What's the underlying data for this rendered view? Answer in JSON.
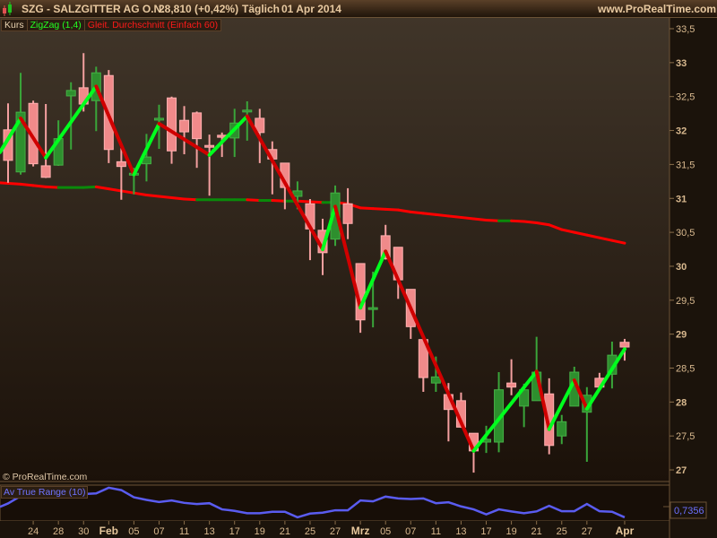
{
  "header": {
    "symbol_title": "SZG - SALZGITTER AG O.N.",
    "price_change": "28,810 (+0,42%)",
    "period": "Täglich",
    "date": "01 Apr 2014",
    "website": "www.ProRealTime.com",
    "icon": "candlestick-icon"
  },
  "legend": {
    "price": "Kurs",
    "zigzag": "ZigZag (1,4)",
    "ma": "Gleit. Durchschnitt (Einfach 60)"
  },
  "copyright": "© ProRealTime.com",
  "atr": {
    "label": "Av True Range (10)",
    "current_value": "0,7356"
  },
  "colors": {
    "up": "#2e8f2e",
    "down": "#f08a8a",
    "zigzag_up": "#00ff1e",
    "zigzag_down": "#d00000",
    "ma": "#ff0000",
    "atr": "#5a5cf0",
    "axis_text": "#d9b98f"
  },
  "chart_data": [
    {
      "type": "candlestick",
      "title": "SZG - SALZGITTER AG O.N.",
      "ylim": [
        26.75,
        33.6
      ],
      "y_ticks": [
        "33,5",
        "33",
        "32,5",
        "32",
        "31,5",
        "31",
        "30,5",
        "30",
        "29,5",
        "29",
        "28,5",
        "28",
        "27,5",
        "27"
      ],
      "y_tick_values": [
        33.5,
        33,
        32.5,
        32,
        31.5,
        31,
        30.5,
        30,
        29.5,
        29,
        28.5,
        28,
        27.5,
        27
      ],
      "x_ticks": [
        {
          "label": "24",
          "idx": 3
        },
        {
          "label": "28",
          "idx": 5
        },
        {
          "label": "30",
          "idx": 7
        },
        {
          "label": "Feb",
          "idx": 9,
          "major": true
        },
        {
          "label": "05",
          "idx": 11
        },
        {
          "label": "07",
          "idx": 13
        },
        {
          "label": "11",
          "idx": 15
        },
        {
          "label": "13",
          "idx": 17
        },
        {
          "label": "17",
          "idx": 19
        },
        {
          "label": "19",
          "idx": 21
        },
        {
          "label": "21",
          "idx": 23
        },
        {
          "label": "25",
          "idx": 25
        },
        {
          "label": "27",
          "idx": 27
        },
        {
          "label": "Mrz",
          "idx": 29,
          "major": true
        },
        {
          "label": "05",
          "idx": 31
        },
        {
          "label": "07",
          "idx": 33
        },
        {
          "label": "11",
          "idx": 35
        },
        {
          "label": "13",
          "idx": 37
        },
        {
          "label": "17",
          "idx": 39
        },
        {
          "label": "19",
          "idx": 41
        },
        {
          "label": "21",
          "idx": 43
        },
        {
          "label": "25",
          "idx": 45
        },
        {
          "label": "27",
          "idx": 47
        },
        {
          "label": "Apr",
          "idx": 50,
          "major": true
        }
      ],
      "ohlc": [
        [
          32.01,
          32.4,
          31.23,
          31.56
        ],
        [
          31.39,
          32.85,
          31.35,
          32.27
        ],
        [
          32.4,
          32.44,
          31.47,
          31.51
        ],
        [
          31.48,
          32.39,
          31.3,
          31.31
        ],
        [
          31.49,
          32.15,
          31.48,
          31.88
        ],
        [
          32.51,
          32.71,
          31.72,
          32.59
        ],
        [
          32.63,
          33.14,
          32.28,
          32.39
        ],
        [
          32.44,
          32.94,
          31.99,
          32.85
        ],
        [
          32.81,
          32.89,
          31.52,
          31.72
        ],
        [
          31.54,
          31.74,
          30.98,
          31.47
        ],
        [
          31.36,
          31.45,
          31.06,
          31.37
        ],
        [
          31.51,
          31.95,
          31.25,
          31.61
        ],
        [
          32.17,
          32.38,
          31.73,
          32.18
        ],
        [
          32.48,
          32.5,
          31.51,
          31.7
        ],
        [
          32.15,
          32.36,
          31.65,
          31.98
        ],
        [
          32.26,
          32.28,
          31.45,
          31.88
        ],
        [
          31.78,
          31.94,
          31.04,
          31.76
        ],
        [
          31.93,
          31.97,
          31.61,
          31.9
        ],
        [
          31.89,
          32.32,
          31.61,
          32.11
        ],
        [
          32.29,
          32.43,
          31.85,
          32.3
        ],
        [
          32.18,
          32.32,
          31.52,
          31.97
        ],
        [
          31.72,
          31.84,
          31.06,
          31.58
        ],
        [
          31.52,
          31.52,
          30.84,
          31.16
        ],
        [
          31.03,
          31.25,
          30.84,
          31.11
        ],
        [
          30.92,
          30.99,
          30.09,
          30.55
        ],
        [
          30.53,
          30.7,
          29.87,
          30.2
        ],
        [
          30.4,
          31.19,
          30.3,
          31.08
        ],
        [
          30.92,
          31.15,
          30.4,
          30.63
        ],
        [
          30.04,
          30.04,
          29.02,
          29.21
        ],
        [
          29.38,
          29.92,
          29.1,
          29.39
        ],
        [
          30.45,
          30.61,
          30.1,
          30.11
        ],
        [
          30.28,
          30.28,
          29.52,
          29.8
        ],
        [
          29.66,
          29.66,
          28.93,
          29.11
        ],
        [
          28.92,
          28.92,
          28.15,
          28.36
        ],
        [
          28.28,
          28.67,
          28.15,
          28.37
        ],
        [
          28.11,
          28.28,
          27.42,
          27.89
        ],
        [
          28.02,
          28.14,
          27.62,
          27.63
        ],
        [
          27.54,
          27.54,
          26.96,
          27.28
        ],
        [
          27.41,
          27.65,
          27.25,
          27.45
        ],
        [
          27.41,
          28.44,
          27.26,
          28.18
        ],
        [
          28.28,
          28.63,
          28.1,
          28.22
        ],
        [
          27.94,
          28.27,
          27.63,
          28.18
        ],
        [
          28.02,
          28.96,
          28.02,
          28.44
        ],
        [
          28.12,
          28.35,
          27.23,
          27.36
        ],
        [
          27.5,
          27.81,
          27.38,
          27.71
        ],
        [
          27.94,
          28.52,
          27.94,
          28.44
        ],
        [
          27.85,
          28.22,
          27.12,
          28.1
        ],
        [
          28.35,
          28.43,
          28.22,
          28.22
        ],
        [
          28.41,
          28.89,
          28.2,
          28.69
        ],
        [
          28.88,
          28.93,
          28.61,
          28.81
        ]
      ],
      "zigzag": [
        [
          0.35,
          31.68
        ],
        [
          2,
          32.18
        ],
        [
          4,
          31.6
        ],
        [
          8,
          32.65
        ],
        [
          11,
          31.35
        ],
        [
          13,
          32.1
        ],
        [
          17,
          31.64
        ],
        [
          20,
          32.21
        ],
        [
          26,
          30.25
        ],
        [
          27,
          30.88
        ],
        [
          29,
          29.39
        ],
        [
          31,
          30.22
        ],
        [
          38,
          27.28
        ],
        [
          43,
          28.45
        ],
        [
          44,
          27.6
        ],
        [
          46,
          28.32
        ],
        [
          47,
          27.9
        ],
        [
          50,
          28.78
        ]
      ],
      "ma60": [
        31.23,
        31.21,
        31.19,
        31.17,
        31.16,
        31.16,
        31.16,
        31.17,
        31.14,
        31.11,
        31.08,
        31.05,
        31.03,
        31.01,
        30.99,
        30.98,
        30.98,
        30.98,
        30.98,
        30.98,
        30.97,
        30.97,
        30.96,
        30.96,
        30.95,
        30.94,
        30.94,
        30.92,
        30.86,
        30.85,
        30.84,
        30.83,
        30.8,
        30.78,
        30.76,
        30.74,
        30.72,
        30.7,
        30.68,
        30.67,
        30.67,
        30.66,
        30.64,
        30.61,
        30.54,
        30.5,
        30.46,
        30.42,
        30.38,
        30.34
      ]
    },
    {
      "type": "line",
      "title": "Av True Range (10)",
      "values": [
        0.858,
        0.923,
        0.93,
        0.935,
        0.94,
        0.94,
        0.94,
        0.946,
        0.996,
        0.975,
        0.912,
        0.889,
        0.871,
        0.884,
        0.863,
        0.853,
        0.86,
        0.806,
        0.793,
        0.772,
        0.772,
        0.785,
        0.785,
        0.736,
        0.769,
        0.777,
        0.798,
        0.798,
        0.884,
        0.876,
        0.918,
        0.902,
        0.897,
        0.902,
        0.86,
        0.868,
        0.832,
        0.806,
        0.762,
        0.806,
        0.788,
        0.772,
        0.788,
        0.837,
        0.79,
        0.79,
        0.853,
        0.79,
        0.785,
        0.736
      ]
    }
  ]
}
